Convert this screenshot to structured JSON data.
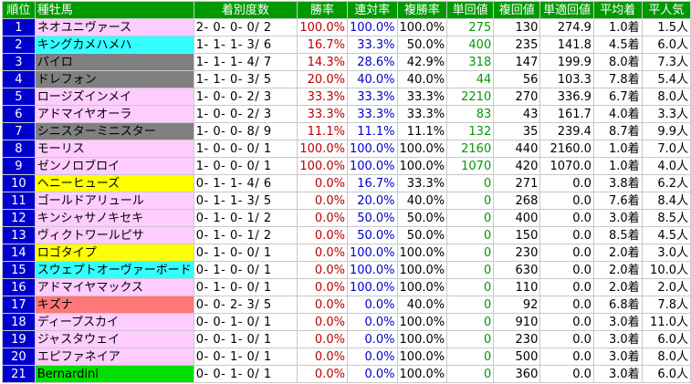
{
  "colors": {
    "header_bg": "#009900",
    "rank_bg": "#0000cc",
    "pink": "#ffccff",
    "cyan": "#33ffff",
    "gray": "#808080",
    "yellow": "#ffff00",
    "salmon": "#ff7777",
    "green": "#00dd00",
    "win_rate_text": "#bb0000",
    "quinella_rate_text": "#0000cc",
    "win_return_text": "#009900"
  },
  "table": {
    "headers": [
      "順位",
      "種牡馬",
      "着別度数",
      "勝率",
      "連対率",
      "複勝率",
      "単回値",
      "複回値",
      "単適回値",
      "平均着",
      "平人気"
    ],
    "rows": [
      {
        "rank": "1",
        "sire": "ネオユニヴァース",
        "bg": "#ffccff",
        "record": "2- 0- 0- 0/ 2",
        "win": "100.0%",
        "quin": "100.0%",
        "show": "100.0%",
        "tan": "275",
        "fuku": "130",
        "tanadj": "274.9",
        "avg": "1.0着",
        "pop": "1.5人"
      },
      {
        "rank": "2",
        "sire": "キングカメハメハ",
        "bg": "#33ffff",
        "record": "1- 1- 1- 3/ 6",
        "win": "16.7%",
        "quin": "33.3%",
        "show": "50.0%",
        "tan": "400",
        "fuku": "235",
        "tanadj": "141.8",
        "avg": "4.5着",
        "pop": "6.0人"
      },
      {
        "rank": "3",
        "sire": "パイロ",
        "bg": "#808080",
        "record": "1- 1- 1- 4/ 7",
        "win": "14.3%",
        "quin": "28.6%",
        "show": "42.9%",
        "tan": "318",
        "fuku": "147",
        "tanadj": "199.9",
        "avg": "8.0着",
        "pop": "7.3人"
      },
      {
        "rank": "4",
        "sire": "ドレフォン",
        "bg": "#808080",
        "record": "1- 1- 0- 3/ 5",
        "win": "20.0%",
        "quin": "40.0%",
        "show": "40.0%",
        "tan": "44",
        "fuku": "56",
        "tanadj": "103.3",
        "avg": "7.8着",
        "pop": "5.4人"
      },
      {
        "rank": "5",
        "sire": "ロージズインメイ",
        "bg": "#ffccff",
        "record": "1- 0- 0- 2/ 3",
        "win": "33.3%",
        "quin": "33.3%",
        "show": "33.3%",
        "tan": "2210",
        "fuku": "270",
        "tanadj": "336.9",
        "avg": "6.7着",
        "pop": "8.0人"
      },
      {
        "rank": "6",
        "sire": "アドマイヤオーラ",
        "bg": "#ffccff",
        "record": "1- 0- 0- 2/ 3",
        "win": "33.3%",
        "quin": "33.3%",
        "show": "33.3%",
        "tan": "83",
        "fuku": "43",
        "tanadj": "161.7",
        "avg": "4.0着",
        "pop": "3.3人"
      },
      {
        "rank": "7",
        "sire": "シニスターミニスター",
        "bg": "#808080",
        "record": "1- 0- 0- 8/ 9",
        "win": "11.1%",
        "quin": "11.1%",
        "show": "11.1%",
        "tan": "132",
        "fuku": "35",
        "tanadj": "239.4",
        "avg": "8.7着",
        "pop": "9.9人"
      },
      {
        "rank": "8",
        "sire": "モーリス",
        "bg": "#ffccff",
        "record": "1- 0- 0- 0/ 1",
        "win": "100.0%",
        "quin": "100.0%",
        "show": "100.0%",
        "tan": "2160",
        "fuku": "440",
        "tanadj": "2160.0",
        "avg": "1.0着",
        "pop": "7.0人"
      },
      {
        "rank": "9",
        "sire": "ゼンノロブロイ",
        "bg": "#ffccff",
        "record": "1- 0- 0- 0/ 1",
        "win": "100.0%",
        "quin": "100.0%",
        "show": "100.0%",
        "tan": "1070",
        "fuku": "420",
        "tanadj": "1070.0",
        "avg": "1.0着",
        "pop": "4.0人"
      },
      {
        "rank": "10",
        "sire": "ヘニーヒューズ",
        "bg": "#ffff00",
        "record": "0- 1- 1- 4/ 6",
        "win": "0.0%",
        "quin": "16.7%",
        "show": "33.3%",
        "tan": "0",
        "fuku": "271",
        "tanadj": "0.0",
        "avg": "3.8着",
        "pop": "6.2人"
      },
      {
        "rank": "11",
        "sire": "ゴールドアリュール",
        "bg": "#ffccff",
        "record": "0- 1- 1- 3/ 5",
        "win": "0.0%",
        "quin": "20.0%",
        "show": "40.0%",
        "tan": "0",
        "fuku": "268",
        "tanadj": "0.0",
        "avg": "7.6着",
        "pop": "8.4人"
      },
      {
        "rank": "12",
        "sire": "キンシャサノキセキ",
        "bg": "#ffccff",
        "record": "0- 1- 0- 1/ 2",
        "win": "0.0%",
        "quin": "50.0%",
        "show": "50.0%",
        "tan": "0",
        "fuku": "400",
        "tanadj": "0.0",
        "avg": "3.0着",
        "pop": "8.5人"
      },
      {
        "rank": "13",
        "sire": "ヴィクトワールピサ",
        "bg": "#ffccff",
        "record": "0- 1- 0- 1/ 2",
        "win": "0.0%",
        "quin": "50.0%",
        "show": "50.0%",
        "tan": "0",
        "fuku": "150",
        "tanadj": "0.0",
        "avg": "8.5着",
        "pop": "4.5人"
      },
      {
        "rank": "14",
        "sire": "ロゴタイプ",
        "bg": "#ffff00",
        "record": "0- 1- 0- 0/ 1",
        "win": "0.0%",
        "quin": "100.0%",
        "show": "100.0%",
        "tan": "0",
        "fuku": "230",
        "tanadj": "0.0",
        "avg": "2.0着",
        "pop": "3.0人"
      },
      {
        "rank": "15",
        "sire": "スウェプトオーヴァーボード",
        "bg": "#33ffff",
        "record": "0- 1- 0- 0/ 1",
        "win": "0.0%",
        "quin": "100.0%",
        "show": "100.0%",
        "tan": "0",
        "fuku": "630",
        "tanadj": "0.0",
        "avg": "2.0着",
        "pop": "10.0人"
      },
      {
        "rank": "16",
        "sire": "アドマイヤマックス",
        "bg": "#ffccff",
        "record": "0- 1- 0- 0/ 1",
        "win": "0.0%",
        "quin": "100.0%",
        "show": "100.0%",
        "tan": "0",
        "fuku": "110",
        "tanadj": "0.0",
        "avg": "2.0着",
        "pop": "2.0人"
      },
      {
        "rank": "17",
        "sire": "キズナ",
        "bg": "#ff7777",
        "record": "0- 0- 2- 3/ 5",
        "win": "0.0%",
        "quin": "0.0%",
        "show": "40.0%",
        "tan": "0",
        "fuku": "92",
        "tanadj": "0.0",
        "avg": "6.8着",
        "pop": "7.8人"
      },
      {
        "rank": "18",
        "sire": "ディープスカイ",
        "bg": "#ffccff",
        "record": "0- 0- 1- 0/ 1",
        "win": "0.0%",
        "quin": "0.0%",
        "show": "100.0%",
        "tan": "0",
        "fuku": "910",
        "tanadj": "0.0",
        "avg": "3.0着",
        "pop": "11.0人"
      },
      {
        "rank": "19",
        "sire": "ジャスタウェイ",
        "bg": "#ffccff",
        "record": "0- 0- 1- 0/ 1",
        "win": "0.0%",
        "quin": "0.0%",
        "show": "100.0%",
        "tan": "0",
        "fuku": "230",
        "tanadj": "0.0",
        "avg": "3.0着",
        "pop": "6.0人"
      },
      {
        "rank": "20",
        "sire": "エピファネイア",
        "bg": "#ffccff",
        "record": "0- 0- 1- 0/ 1",
        "win": "0.0%",
        "quin": "0.0%",
        "show": "100.0%",
        "tan": "0",
        "fuku": "500",
        "tanadj": "0.0",
        "avg": "3.0着",
        "pop": "8.0人"
      },
      {
        "rank": "21",
        "sire": "Bernardini",
        "bg": "#00dd00",
        "record": "0- 0- 1- 0/ 1",
        "win": "0.0%",
        "quin": "0.0%",
        "show": "100.0%",
        "tan": "0",
        "fuku": "360",
        "tanadj": "0.0",
        "avg": "3.0着",
        "pop": "6.0人"
      }
    ]
  }
}
